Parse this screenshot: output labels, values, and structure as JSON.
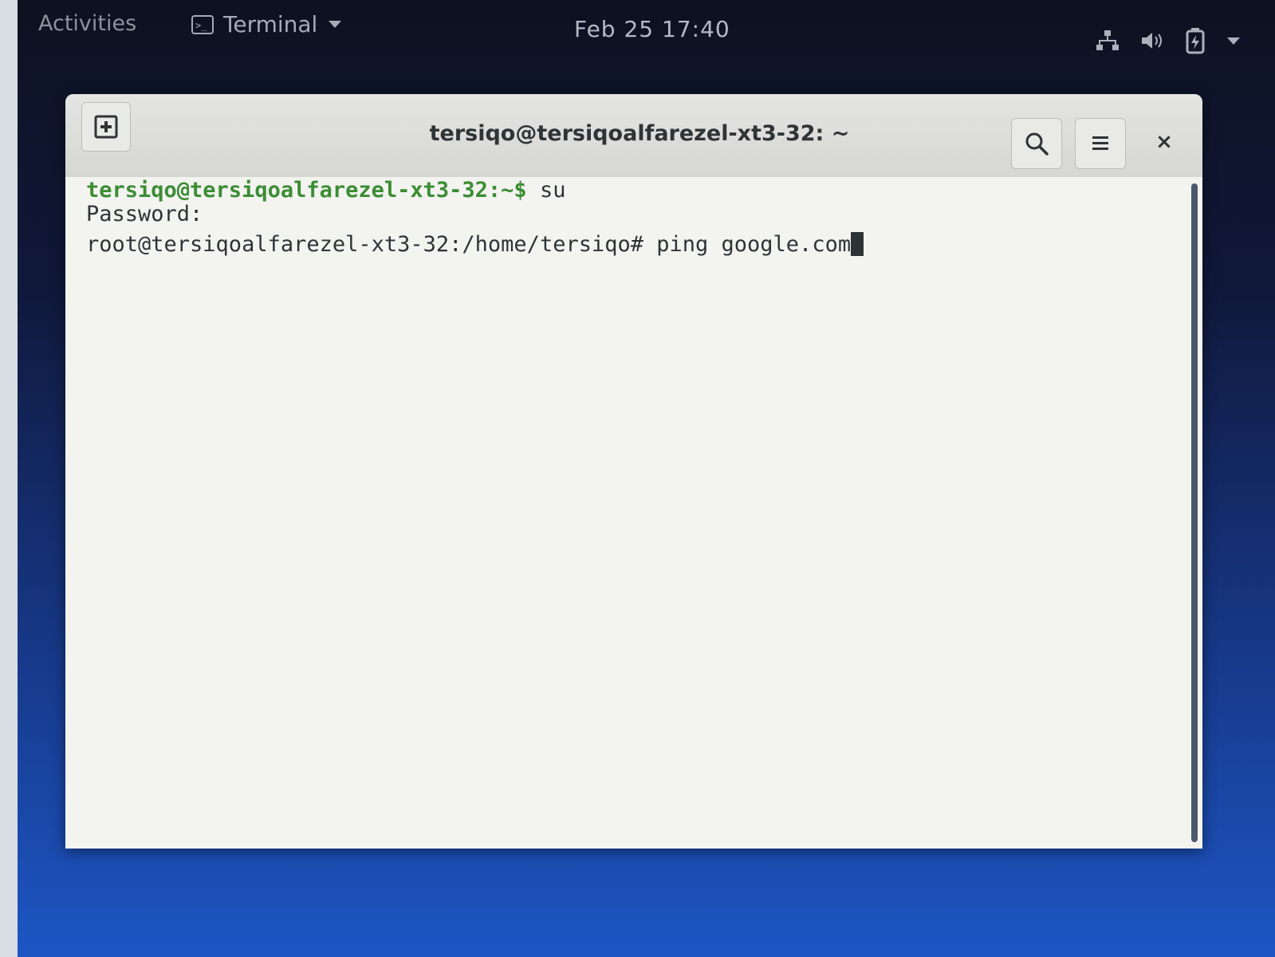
{
  "topbar": {
    "activities": "Activities",
    "app_name": "Terminal",
    "clock": "Feb 25  17:40",
    "tray_icons": [
      "network-icon",
      "volume-icon",
      "battery-icon",
      "system-menu-caret-icon"
    ]
  },
  "window": {
    "title": "tersiqo@tersiqoalfarezel-xt3-32: ~",
    "new_tab_icon": "new-tab-icon",
    "search_icon": "search-icon",
    "menu_icon": "hamburger-menu-icon",
    "close_label": "×"
  },
  "terminal": {
    "line1_prompt": "tersiqo@tersiqoalfarezel-xt3-32",
    "line1_path": ":~$ ",
    "line1_cmd": "su",
    "line2": "Password:",
    "line3_prompt": "root@tersiqoalfarezel-xt3-32:/home/tersiqo# ",
    "line3_cmd": "ping google.com"
  },
  "colors": {
    "prompt_green": "#3b8d34",
    "terminal_bg": "#f3f3f0",
    "terminal_fg": "#2e3436"
  }
}
